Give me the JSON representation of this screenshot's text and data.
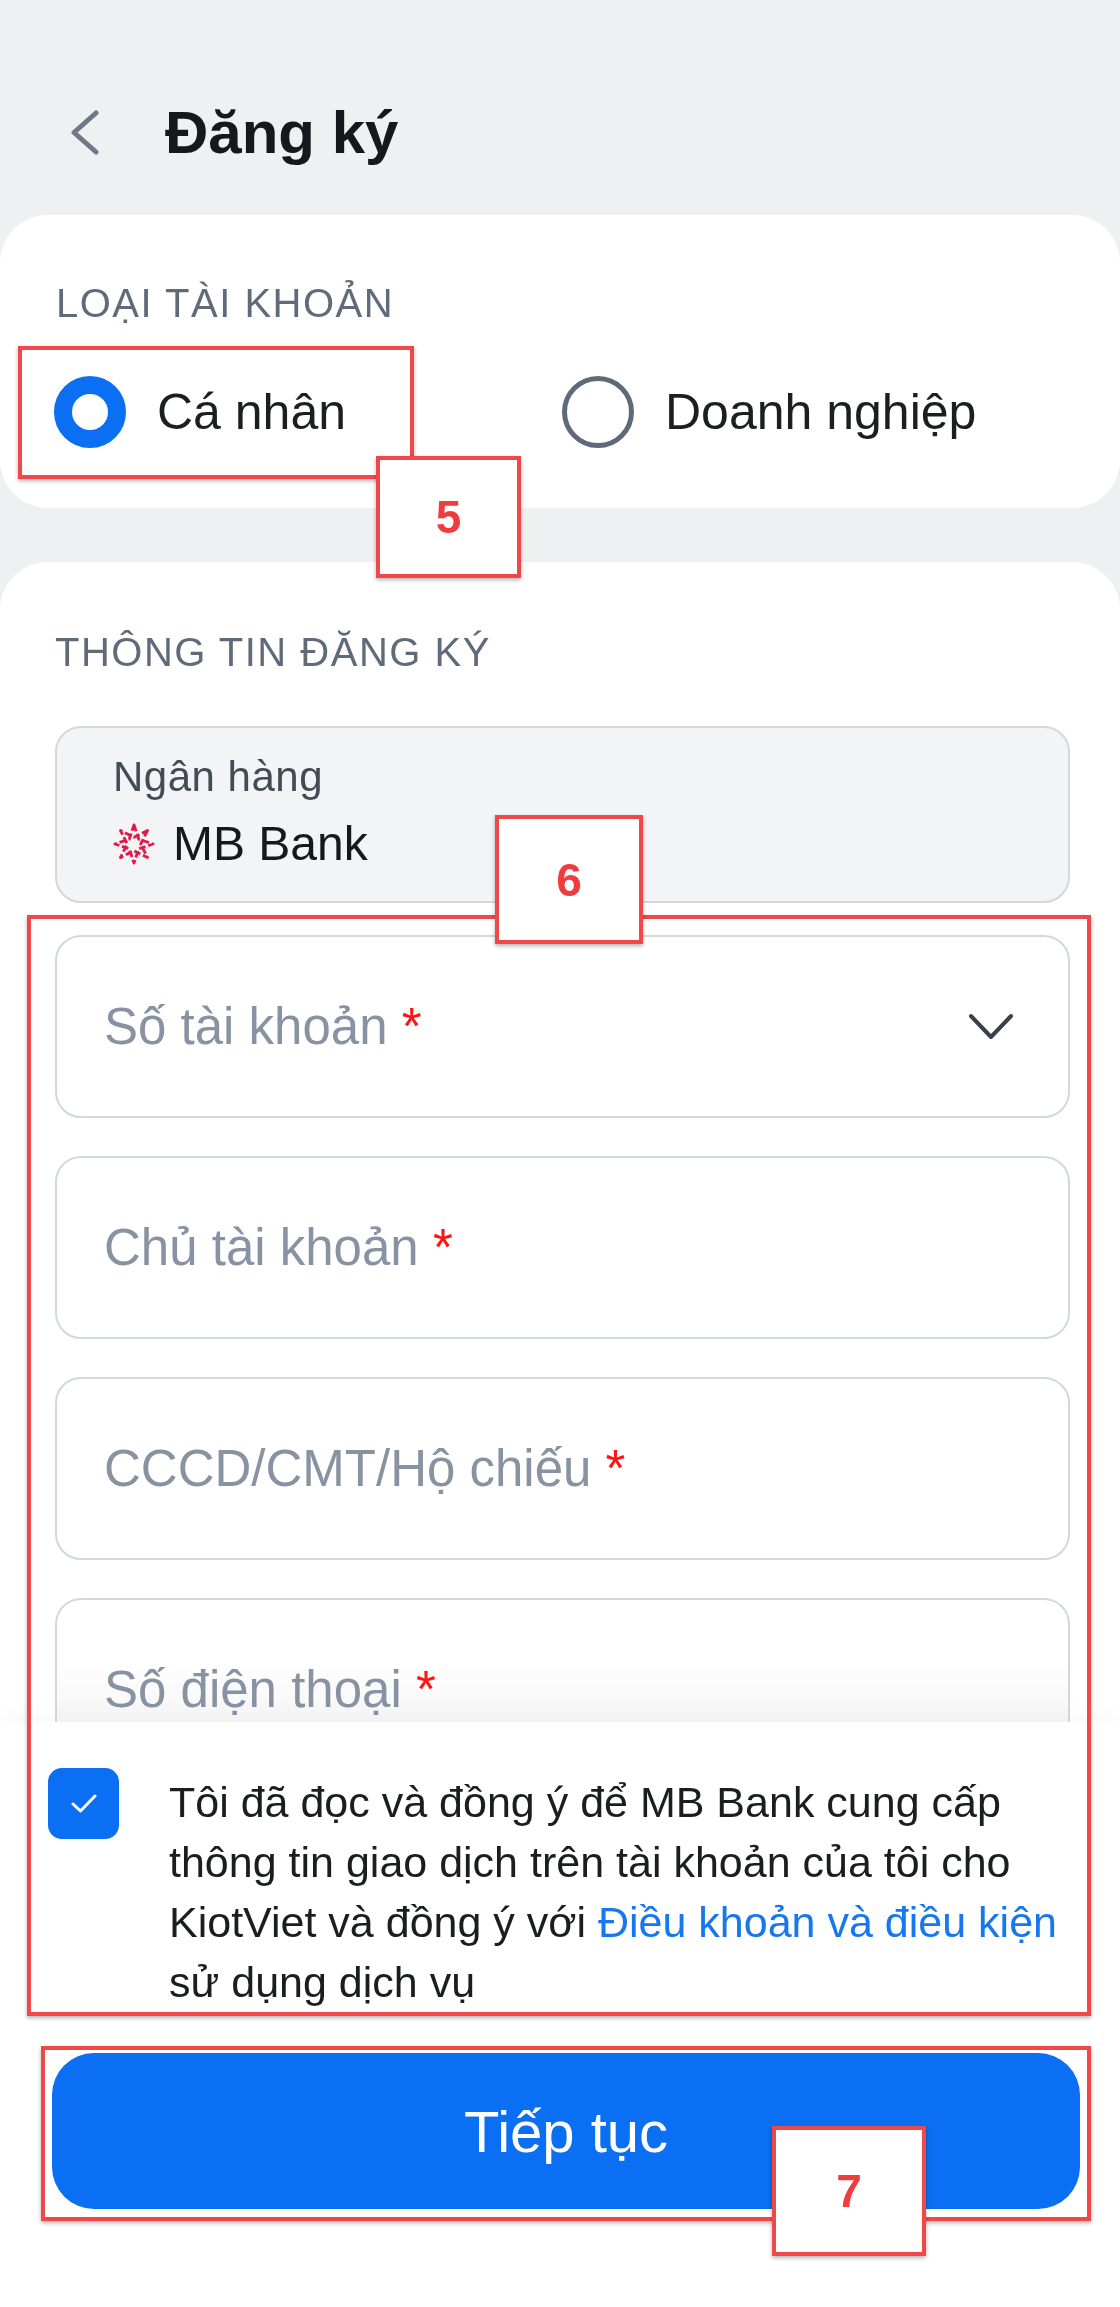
{
  "header": {
    "title": "Đăng ký"
  },
  "account_type": {
    "heading": "LOẠI TÀI KHOẢN",
    "options": [
      {
        "label": "Cá nhân",
        "selected": true
      },
      {
        "label": "Doanh nghiệp",
        "selected": false
      }
    ]
  },
  "registration": {
    "heading": "THÔNG TIN ĐĂNG KÝ",
    "bank_field": {
      "label": "Ngân hàng",
      "value": "MB Bank",
      "disabled": true
    },
    "fields": [
      {
        "kind": "dropdown",
        "placeholder": "Số tài khoản",
        "required_mark": "*"
      },
      {
        "kind": "text",
        "placeholder": "Chủ tài khoản",
        "required_mark": "*"
      },
      {
        "kind": "text",
        "placeholder": "CCCD/CMT/Hộ chiếu",
        "required_mark": "*"
      },
      {
        "kind": "text",
        "placeholder": "Số điện thoại",
        "required_mark": "*"
      }
    ]
  },
  "consent": {
    "checked": true,
    "text_before": "Tôi đã đọc và đồng ý để MB Bank cung cấp thông tin giao dịch trên tài khoản của tôi cho KiotViet và đồng ý với",
    "link": "Điều khoản và điều kiện",
    "text_after": "sử dụng dịch vụ"
  },
  "primary_button": {
    "label": "Tiếp tục"
  },
  "annotations": [
    {
      "label": "5"
    },
    {
      "label": "6"
    },
    {
      "label": "7"
    }
  ]
}
